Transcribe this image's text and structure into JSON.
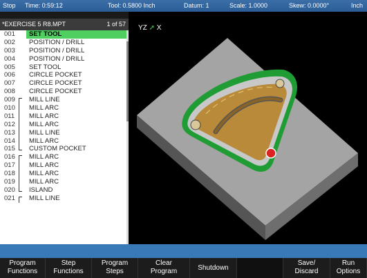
{
  "status": {
    "mode": "Stop",
    "time": "Time: 0:59:12",
    "tool": "Tool: 0.5800 Inch",
    "datum": "Datum: 1",
    "scale": "Scale: 1.0000",
    "skew": "Skew: 0.0000°",
    "unit": "Inch"
  },
  "program": {
    "title": "*EXERCISE 5 R8.MPT",
    "position": "1 of 57"
  },
  "steps": [
    {
      "num": "001",
      "label": "SET TOOL",
      "bracket": ""
    },
    {
      "num": "002",
      "label": "POSITION / DRILL",
      "bracket": ""
    },
    {
      "num": "003",
      "label": "POSITION / DRILL",
      "bracket": ""
    },
    {
      "num": "004",
      "label": "POSITION / DRILL",
      "bracket": ""
    },
    {
      "num": "005",
      "label": "SET TOOL",
      "bracket": ""
    },
    {
      "num": "006",
      "label": "CIRCLE POCKET",
      "bracket": ""
    },
    {
      "num": "007",
      "label": "CIRCLE POCKET",
      "bracket": ""
    },
    {
      "num": "008",
      "label": "CIRCLE POCKET",
      "bracket": ""
    },
    {
      "num": "009",
      "label": "MILL LINE",
      "bracket": "top"
    },
    {
      "num": "010",
      "label": "MILL ARC",
      "bracket": "mid"
    },
    {
      "num": "011",
      "label": "MILL ARC",
      "bracket": "mid"
    },
    {
      "num": "012",
      "label": "MILL ARC",
      "bracket": "mid"
    },
    {
      "num": "013",
      "label": "MILL LINE",
      "bracket": "mid"
    },
    {
      "num": "014",
      "label": "MILL ARC",
      "bracket": "mid"
    },
    {
      "num": "015",
      "label": "CUSTOM POCKET",
      "bracket": "bot"
    },
    {
      "num": "016",
      "label": "MILL ARC",
      "bracket": "top"
    },
    {
      "num": "017",
      "label": "MILL ARC",
      "bracket": "mid"
    },
    {
      "num": "018",
      "label": "MILL ARC",
      "bracket": "mid"
    },
    {
      "num": "019",
      "label": "MILL ARC",
      "bracket": "mid"
    },
    {
      "num": "020",
      "label": "ISLAND",
      "bracket": "bot"
    },
    {
      "num": "021",
      "label": "MILL LINE",
      "bracket": "top"
    }
  ],
  "viewport": {
    "axis_y": "Y",
    "axis_z": "Z",
    "axis_x": "X"
  },
  "softkeys": [
    {
      "l1": "Program",
      "l2": "Functions"
    },
    {
      "l1": "Step",
      "l2": "Functions"
    },
    {
      "l1": "Program",
      "l2": "Steps"
    },
    {
      "l1": "Clear",
      "l2": "Program"
    },
    {
      "l1": "Shutdown",
      "l2": ""
    },
    {
      "l1": "",
      "l2": ""
    },
    {
      "l1": "Save/",
      "l2": "Discard"
    },
    {
      "l1": "Run",
      "l2": "Options"
    }
  ],
  "colors": {
    "statusbar": "#2f65a0",
    "selection": "#4fcf5f",
    "toolbar_strip": "#3a79b8",
    "part_gray": "#9a9a9a",
    "pocket_floor": "#b88a3a",
    "pocket_edge": "#2aa83a"
  }
}
